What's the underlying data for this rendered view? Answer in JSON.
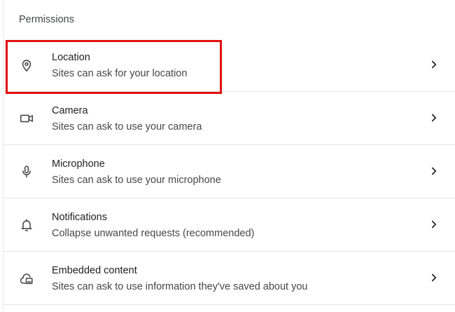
{
  "section": {
    "title": "Permissions"
  },
  "permissions": [
    {
      "label": "Location",
      "description": "Sites can ask for your location",
      "icon": "location-pin-icon"
    },
    {
      "label": "Camera",
      "description": "Sites can ask to use your camera",
      "icon": "camera-icon"
    },
    {
      "label": "Microphone",
      "description": "Sites can ask to use your microphone",
      "icon": "microphone-icon"
    },
    {
      "label": "Notifications",
      "description": "Collapse unwanted requests (recommended)",
      "icon": "bell-icon"
    },
    {
      "label": "Embedded content",
      "description": "Sites can ask to use information they've saved about you",
      "icon": "embedded-content-icon"
    }
  ],
  "highlight": {
    "target": "Location",
    "color": "#e01010"
  },
  "colors": {
    "icon": "#474747",
    "divider": "#e3e3e3"
  }
}
